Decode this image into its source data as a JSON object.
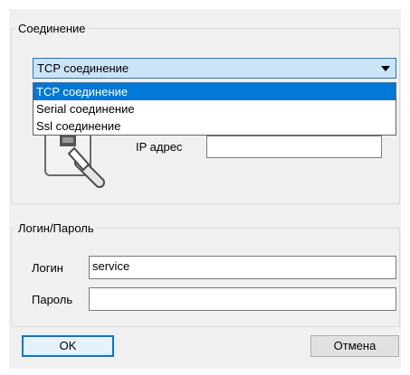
{
  "connection_group": {
    "title": "Соединение",
    "selected": "TCP соединение",
    "options": [
      "TCP соединение",
      "Serial соединение",
      "Ssl соединение"
    ],
    "ip_label": "IP адрес",
    "ip_value": ""
  },
  "login_group": {
    "title": "Логин/Пароль",
    "login_label": "Логин",
    "login_value": "service",
    "password_label": "Пароль",
    "password_value": ""
  },
  "buttons": {
    "ok": "OK",
    "cancel": "Отмена"
  },
  "icons": {
    "connection": "network-plug-icon",
    "dropdown": "chevron-down-icon"
  },
  "colors": {
    "selection": "#0078d7",
    "combo_bg": "#cce4f7"
  }
}
